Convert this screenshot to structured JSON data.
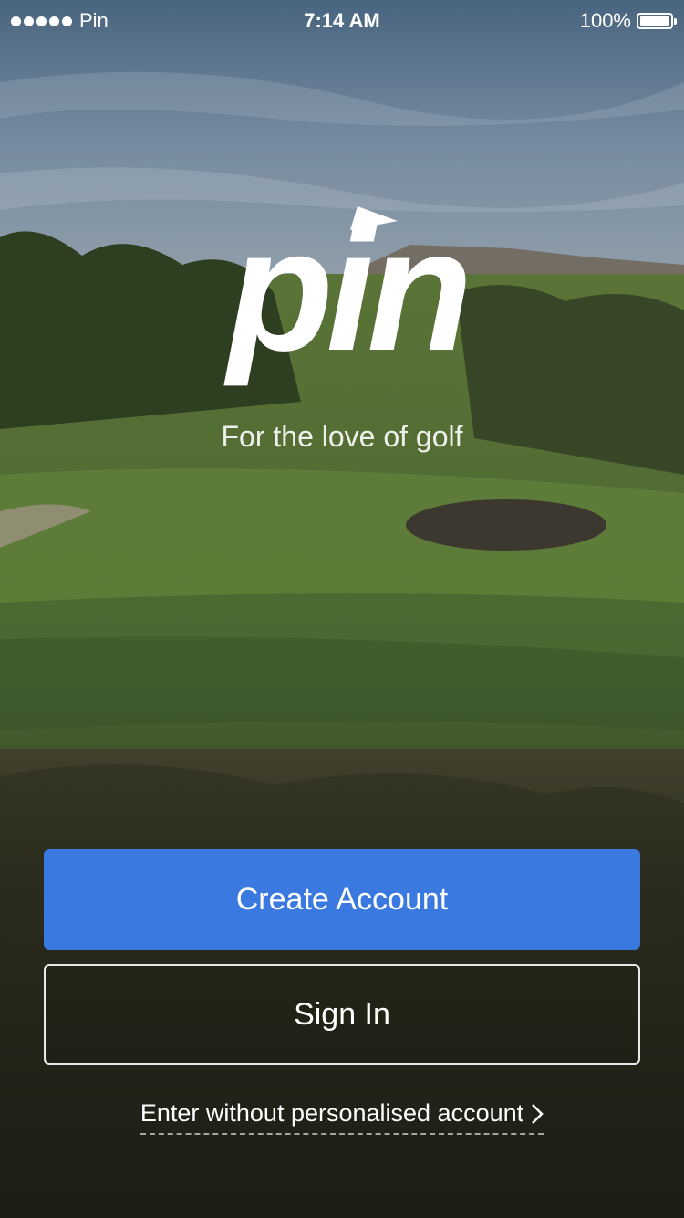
{
  "status_bar": {
    "carrier": "Pin",
    "time": "7:14 AM",
    "battery": "100%"
  },
  "logo": {
    "wordmark": "pin"
  },
  "tagline": "For the love of golf",
  "buttons": {
    "create_account": "Create Account",
    "sign_in": "Sign In"
  },
  "guest_link": {
    "label": "Enter without personalised account"
  },
  "colors": {
    "primary_button": "#3a79e0",
    "text": "#ffffff"
  },
  "icons": {
    "signal": "signal-dots-icon",
    "battery": "battery-icon",
    "logo_flag": "pin-flag-icon",
    "chevron": "chevron-right-icon"
  }
}
